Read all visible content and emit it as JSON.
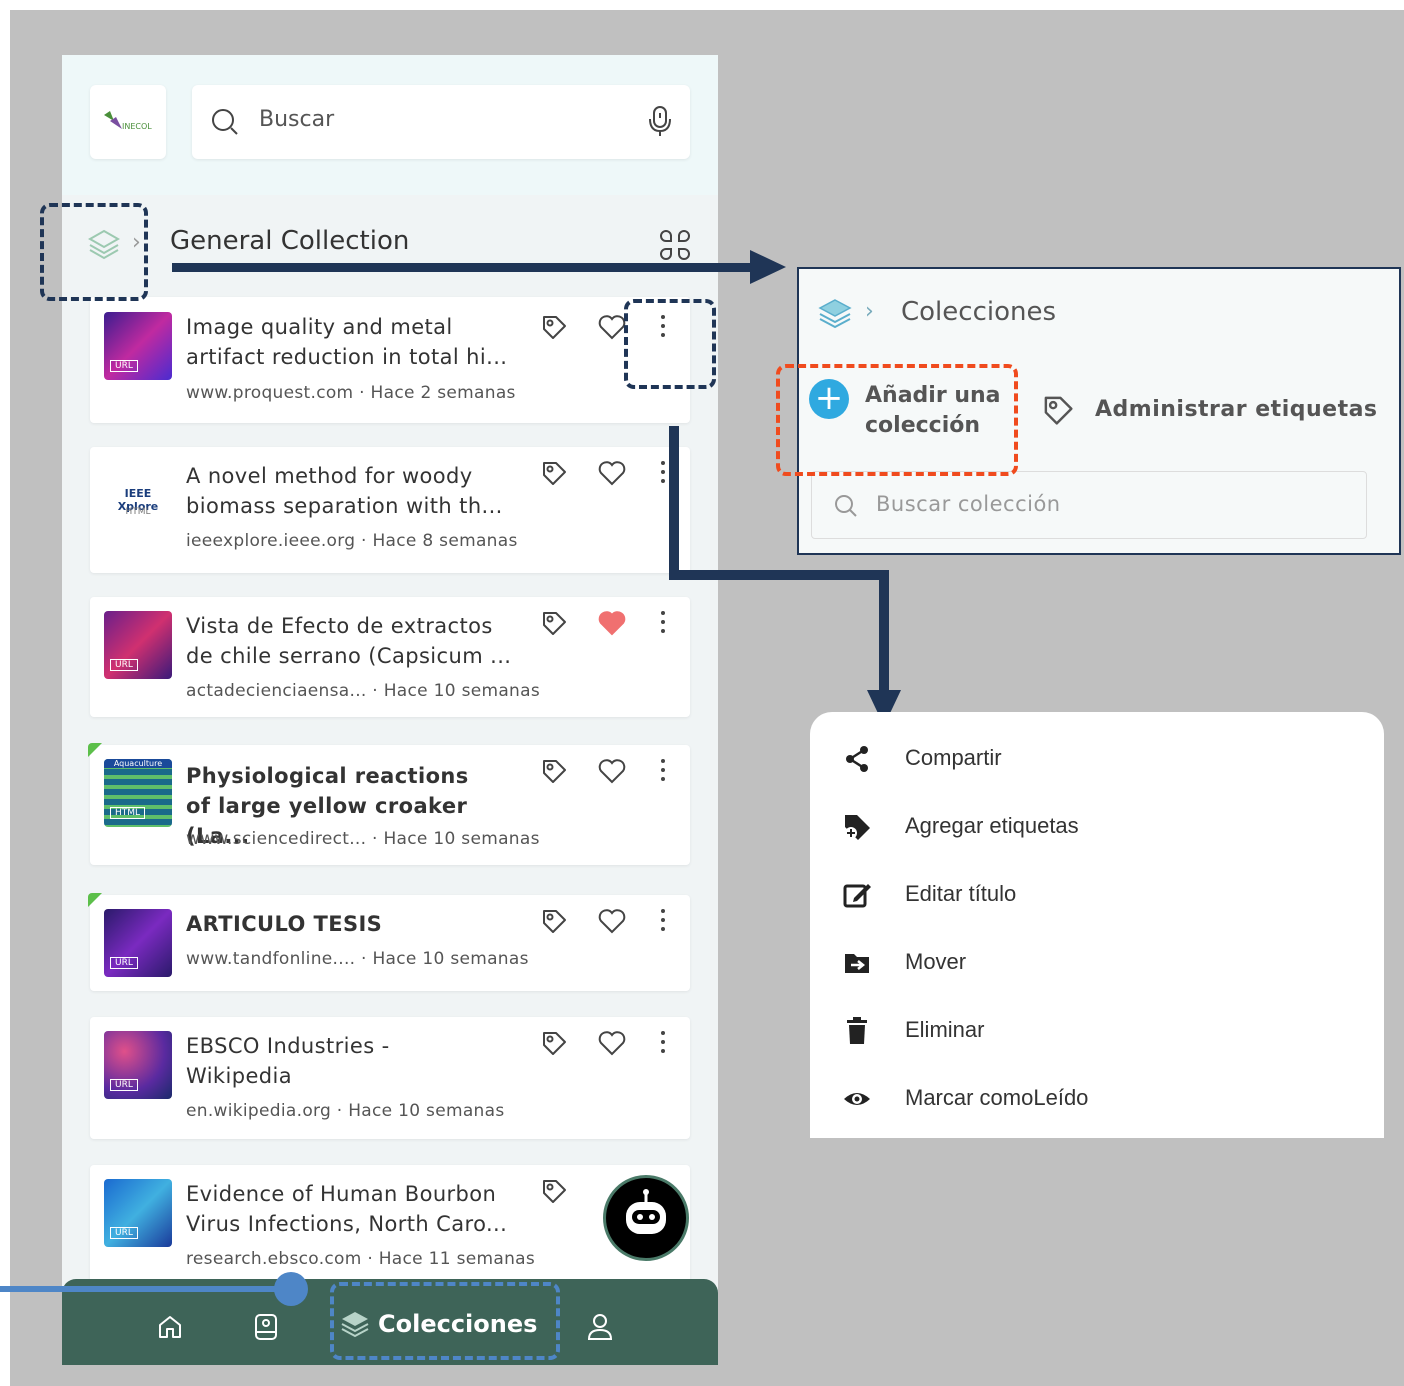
{
  "search": {
    "placeholder": "Buscar",
    "logo_text": "INECOL"
  },
  "header": {
    "collection_title": "General Collection"
  },
  "cards": [
    {
      "line1": "Image quality and metal",
      "line2": "artifact reduction in total hi...",
      "meta": "www.proquest.com · Hace 2 semanas",
      "thumb_label": "URL",
      "favorite": false
    },
    {
      "line1": "A novel method for woody",
      "line2": "biomass separation with th...",
      "meta": "ieeexplore.ieee.org · Hace 8 semanas",
      "thumb_label": "HTML",
      "thumb_brand": "IEEE Xplore",
      "favorite": false
    },
    {
      "line1": "Vista de Efecto de extractos",
      "line2": "de chile serrano (Capsicum ...",
      "meta": "actadecienciaensa... · Hace 10 semanas",
      "thumb_label": "URL",
      "favorite": true
    },
    {
      "line1": "Physiological reactions",
      "line2": "of large yellow croaker (La...",
      "meta": "www.sciencedirect... · Hace 10 semanas",
      "thumb_label": "HTML",
      "thumb_brand": "Aquaculture",
      "favorite": false
    },
    {
      "line1": "ARTICULO TESIS",
      "line2": "",
      "meta": "www.tandfonline....  · Hace 10 semanas",
      "thumb_label": "URL",
      "favorite": false
    },
    {
      "line1": "EBSCO Industries -",
      "line2": "Wikipedia",
      "meta": "en.wikipedia.org · Hace 10 semanas",
      "thumb_label": "URL",
      "favorite": false
    },
    {
      "line1": "Evidence of Human Bourbon",
      "line2": "Virus Infections, North Caro...",
      "meta": "research.ebsco.com · Hace 11 semanas",
      "thumb_label": "URL",
      "favorite": false
    }
  ],
  "bottom_nav": {
    "active_label": "Colecciones"
  },
  "collections_panel": {
    "title": "Colecciones",
    "add_label": "Añadir una colección",
    "manage_tags_label": "Administrar etiquetas",
    "search_placeholder": "Buscar colección"
  },
  "context_menu": {
    "items": [
      {
        "label": "Compartir",
        "icon": "share-icon"
      },
      {
        "label": "Agregar etiquetas",
        "icon": "add-tag-icon"
      },
      {
        "label": "Editar título",
        "icon": "edit-icon"
      },
      {
        "label": "Mover",
        "icon": "move-folder-icon"
      },
      {
        "label": "Eliminar",
        "icon": "trash-icon"
      },
      {
        "label": "Marcar comoLeído",
        "icon": "eye-icon"
      }
    ]
  },
  "colors": {
    "nav_bg": "#3e6458",
    "annotation_dark": "#1f3556",
    "annotation_blue": "#4e86c7",
    "annotation_orange": "#f04b1e",
    "favorite": "#f07070",
    "add_button": "#2fa9e0"
  }
}
